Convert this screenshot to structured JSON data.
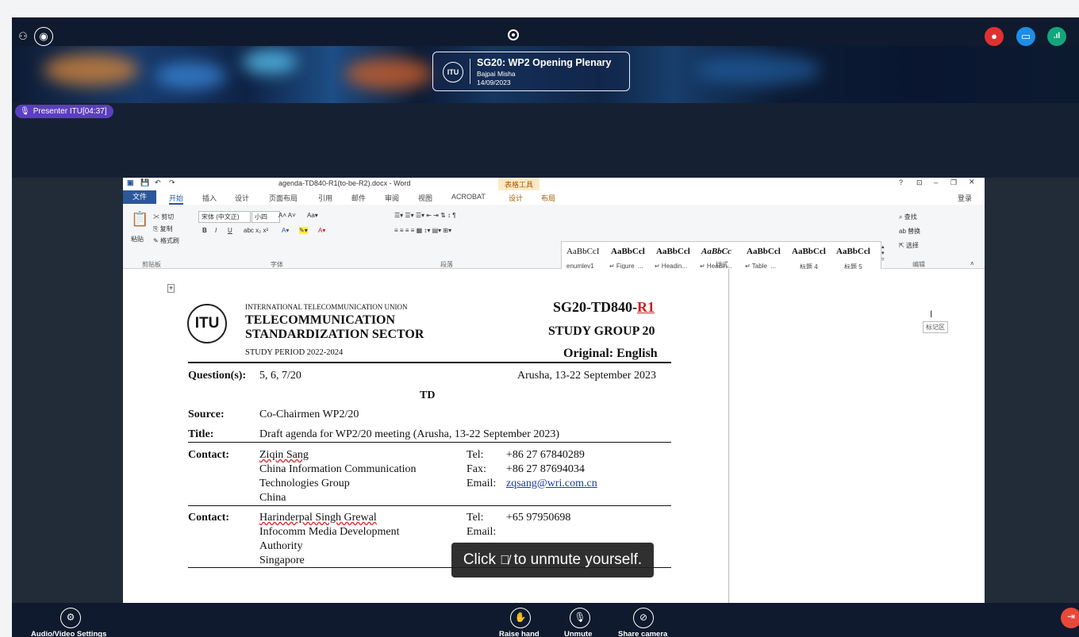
{
  "meeting": {
    "title": "SG20: WP2 Opening Plenary",
    "host": "Bajpai Misha",
    "date": "14/09/2023",
    "logo_text": "ITU",
    "presenter_badge": "Presenter ITU[04:37]"
  },
  "word": {
    "window_title": "agenda-TD840-R1(to-be-R2).docx - Word",
    "table_tools": "表格工具",
    "login": "登录",
    "tabs": [
      "文件",
      "开始",
      "插入",
      "设计",
      "页面布局",
      "引用",
      "邮件",
      "审阅",
      "视图",
      "ACROBAT",
      "设计",
      "布局"
    ],
    "clipboard": {
      "paste": "粘贴",
      "cut": "剪切",
      "copy": "复制",
      "format_painter": "格式刷",
      "group": "剪贴板"
    },
    "font": {
      "name": "宋体 (中文正)",
      "size": "小四",
      "group": "字体"
    },
    "paragraph_group": "段落",
    "styles_group": "样式",
    "editing": {
      "find": "查找",
      "replace": "替换",
      "select": "选择",
      "group": "编辑"
    },
    "styles": [
      {
        "preview": "AaBbCcI",
        "name": "enumlev1"
      },
      {
        "preview": "AaBbCcl",
        "name": "↵ Figure_..."
      },
      {
        "preview": "AaBbCcl",
        "name": "↵ Headin..."
      },
      {
        "preview": "AaBbCc",
        "name": "↵ Headin..."
      },
      {
        "preview": "AaBbCcl",
        "name": "↵ Table_..."
      },
      {
        "preview": "AaBbCcl",
        "name": "标题 4"
      },
      {
        "preview": "AaBbCcl",
        "name": "标题 5"
      }
    ],
    "side_tag": "标记区"
  },
  "document": {
    "itu_union": "INTERNATIONAL TELECOMMUNICATION UNION",
    "sector_line1": "TELECOMMUNICATION",
    "sector_line2": "STANDARDIZATION SECTOR",
    "study_period": "STUDY PERIOD 2022-2024",
    "doc_number": "SG20-TD840-",
    "doc_rev": "R1",
    "study_group": "STUDY GROUP 20",
    "original": "Original: English",
    "question_label": "Question(s):",
    "question_value": "5, 6, 7/20",
    "location": "Arusha, 13-22 September 2023",
    "td": "TD",
    "source_label": "Source:",
    "source_value": "Co-Chairmen WP2/20",
    "title_label": "Title:",
    "title_value": "Draft agenda for WP2/20 meeting (Arusha, 13-22 September 2023)",
    "contact1": {
      "label": "Contact:",
      "name": "Ziqin Sang",
      "org1": "China Information Communication",
      "org2": "Technologies Group",
      "country": "China",
      "tel_label": "Tel:",
      "tel": "+86 27 67840289",
      "fax_label": "Fax:",
      "fax": "+86 27 87694034",
      "email_label": "Email:",
      "email": "zqsang@wri.com.cn"
    },
    "contact2": {
      "label": "Contact:",
      "name": "Harinderpal Singh Grewal",
      "org1": "Infocomm Media Development",
      "org2": "Authority",
      "country": "Singapore",
      "tel_label": "Tel:",
      "tel": "+65 97950698",
      "email_label": "Email:"
    }
  },
  "toast": {
    "before": "Click",
    "after": "to unmute yourself."
  },
  "controls": {
    "av_settings": "Audio/Video Settings",
    "raise_hand": "Raise hand",
    "unmute": "Unmute",
    "share_camera": "Share camera"
  }
}
